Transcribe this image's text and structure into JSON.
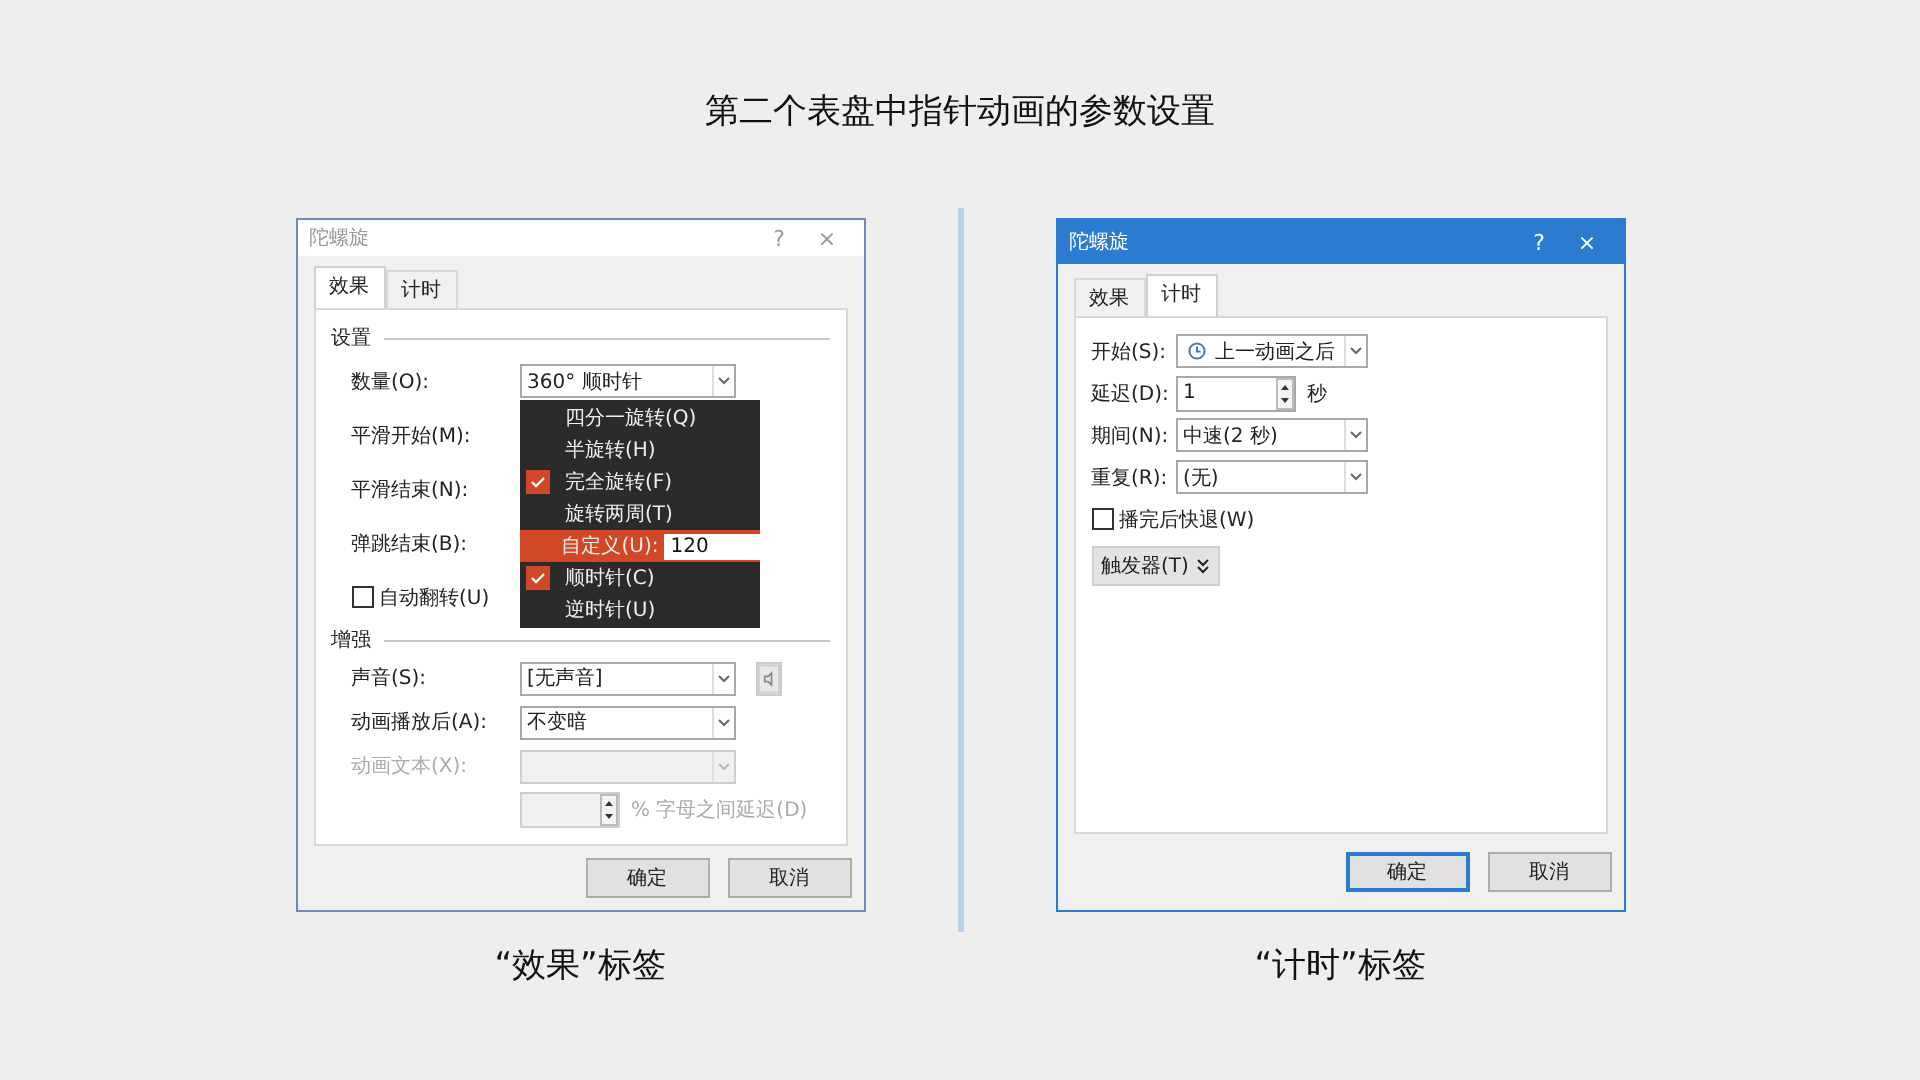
{
  "heading": "第二个表盘中指针动画的参数设置",
  "dialogs": [
    {
      "kind": "effect",
      "active": false,
      "title": "陀螺旋",
      "help": "?",
      "close": "×",
      "tabs": [
        {
          "label": "效果",
          "selected": true
        },
        {
          "label": "计时",
          "selected": false
        }
      ],
      "groups": [
        {
          "title": "设置",
          "rows": [
            {
              "kind": "dropdown",
              "label": "数量(O):",
              "value": "360° 顺时针",
              "disabled": false,
              "menu": [
                {
                  "label": "四分一旋转(Q)",
                  "checked": false,
                  "selected": false
                },
                {
                  "label": "半旋转(H)",
                  "checked": false,
                  "selected": false
                },
                {
                  "label": "完全旋转(F)",
                  "checked": true,
                  "selected": false
                },
                {
                  "label": "旋转两周(T)",
                  "checked": false,
                  "selected": false
                },
                {
                  "label": "自定义(U):",
                  "checked": false,
                  "selected": true,
                  "value": "120"
                },
                {
                  "label": "顺时针(C)",
                  "checked": true,
                  "selected": false
                },
                {
                  "label": "逆时针(U)",
                  "checked": false,
                  "selected": false
                }
              ]
            },
            {
              "kind": "label",
              "label": "平滑开始(M):"
            },
            {
              "kind": "label",
              "label": "平滑结束(N):"
            },
            {
              "kind": "label",
              "label": "弹跳结束(B):"
            },
            {
              "kind": "checkbox",
              "label": "自动翻转(U)",
              "checked": false
            }
          ]
        },
        {
          "title": "增强",
          "rows": [
            {
              "kind": "dropdown",
              "label": "声音(S):",
              "value": "[无声音]",
              "disabled": false,
              "sound_button": true
            },
            {
              "kind": "dropdown",
              "label": "动画播放后(A):",
              "value": "不变暗",
              "disabled": false
            },
            {
              "kind": "dropdown",
              "label": "动画文本(X):",
              "disabled": true
            },
            {
              "kind": "spinner",
              "suffix": "% 字母之间延迟(D)",
              "disabled": true
            }
          ]
        }
      ],
      "buttons": [
        {
          "label": "确定",
          "default": false
        },
        {
          "label": "取消",
          "default": false
        }
      ],
      "caption": "“效果”标签"
    },
    {
      "kind": "timing",
      "active": true,
      "title": "陀螺旋",
      "help": "?",
      "close": "×",
      "tabs": [
        {
          "label": "效果",
          "selected": false
        },
        {
          "label": "计时",
          "selected": true
        }
      ],
      "groups": [
        {
          "rows": [
            {
              "kind": "icon_dropdown",
              "label": "开始(S):",
              "value": "上一动画之后",
              "disabled": false
            },
            {
              "kind": "spinner",
              "label": "延迟(D):",
              "value": "1",
              "suffix": "秒",
              "disabled": false
            },
            {
              "kind": "dropdown",
              "label": "期间(N):",
              "value": "中速(2 秒)",
              "disabled": false
            },
            {
              "kind": "dropdown",
              "label": "重复(R):",
              "value": "(无)",
              "disabled": false
            },
            {
              "kind": "checkbox",
              "label": "播完后快退(W)",
              "checked": false
            },
            {
              "kind": "toggle_button",
              "label": "触发器(T)"
            }
          ]
        }
      ],
      "buttons": [
        {
          "label": "确定",
          "default": true
        },
        {
          "label": "取消",
          "default": false
        }
      ],
      "caption": "“计时”标签"
    }
  ]
}
